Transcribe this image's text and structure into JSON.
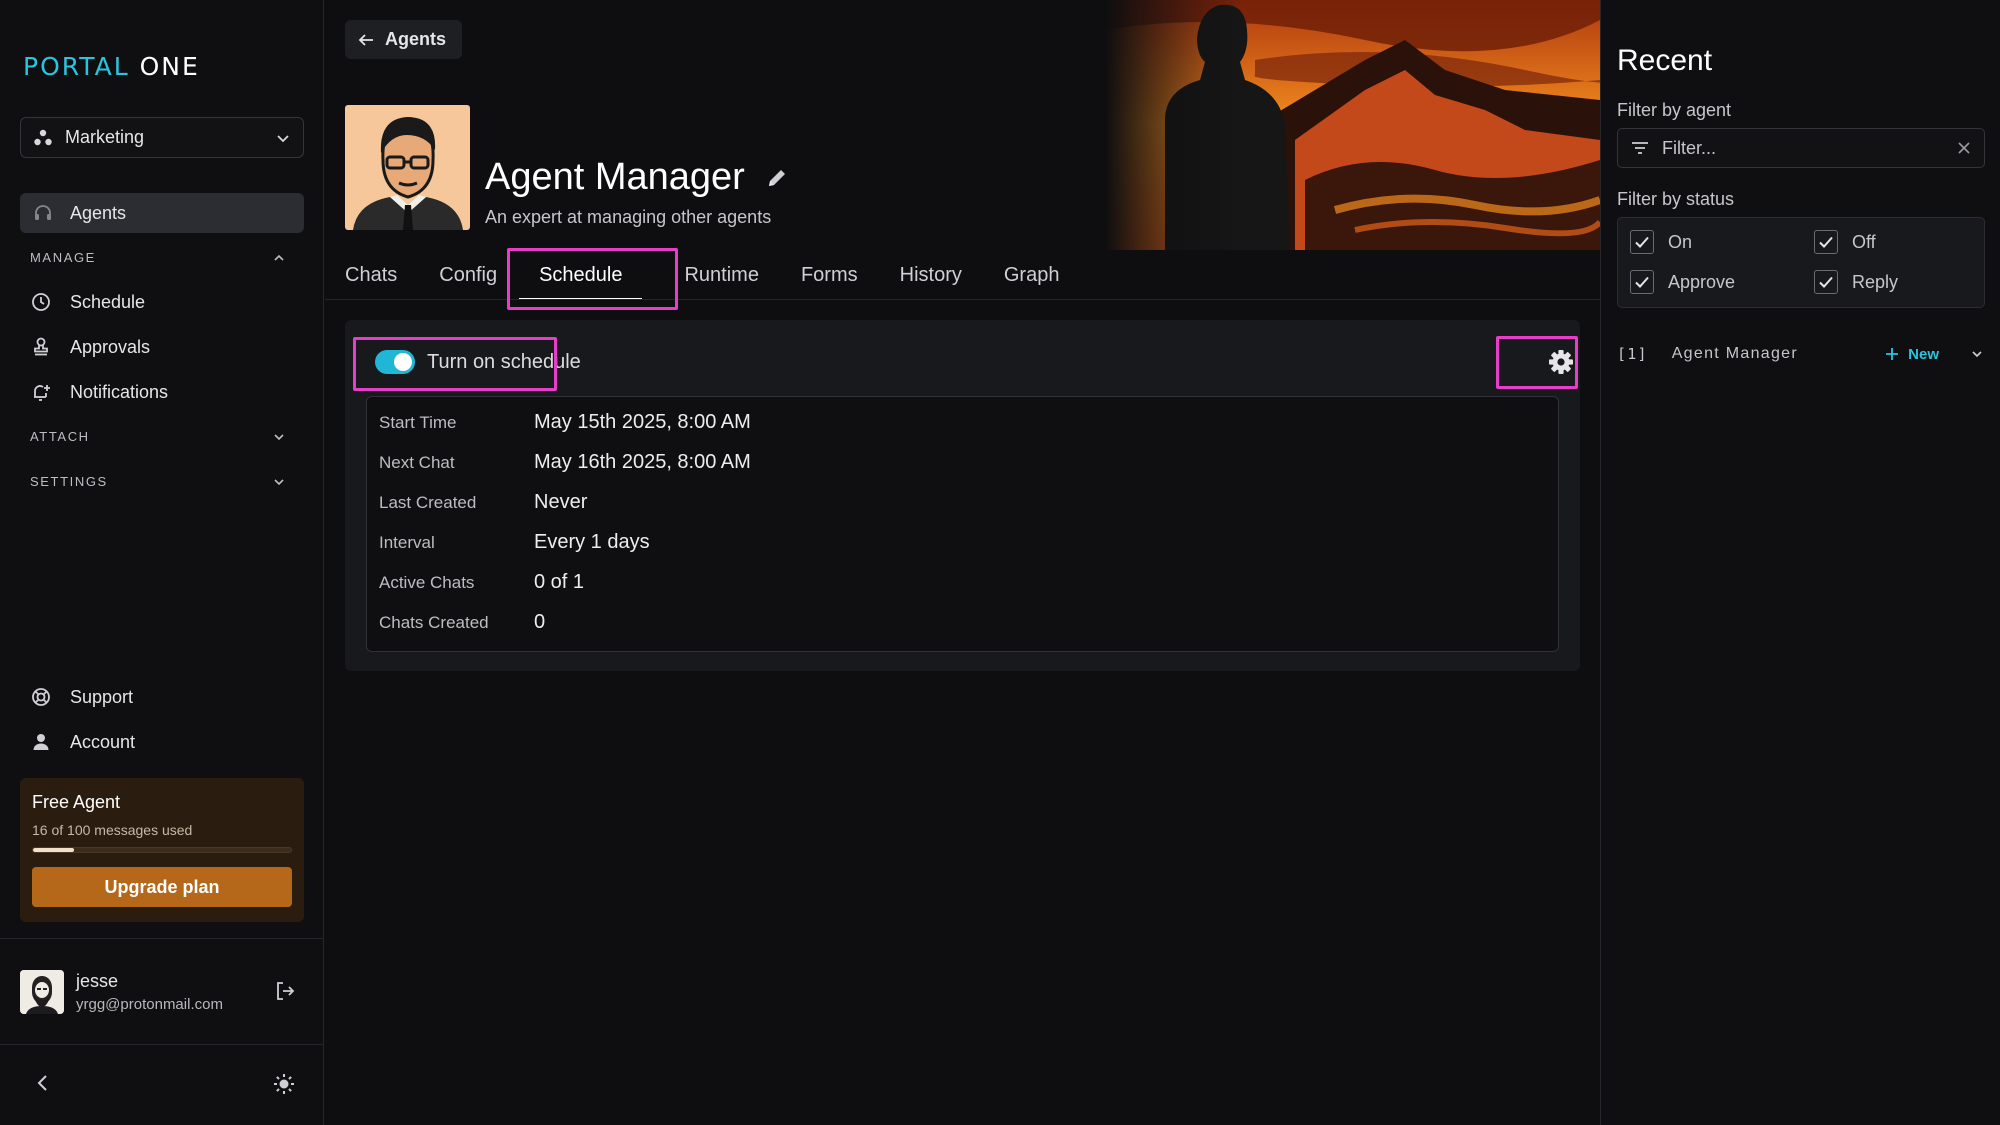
{
  "sidebar": {
    "logo_part1": "PORTAL",
    "logo_part2": "ONE",
    "workspace": "Marketing",
    "active_item": "Agents",
    "manage_header": "MANAGE",
    "manage_items": [
      "Schedule",
      "Approvals",
      "Notifications"
    ],
    "attach_header": "ATTACH",
    "settings_header": "SETTINGS",
    "bottom_items": [
      "Support",
      "Account"
    ],
    "plan": {
      "title": "Free Agent",
      "usage_text": "16 of 100 messages used",
      "usage_fraction": 0.16,
      "upgrade_label": "Upgrade plan"
    },
    "user": {
      "name": "jesse",
      "email": "yrgg@protonmail.com"
    }
  },
  "header": {
    "back_label": "Agents",
    "agent_name": "Agent Manager",
    "agent_description": "An expert at managing other agents"
  },
  "tabs": [
    "Chats",
    "Config",
    "Schedule",
    "Runtime",
    "Forms",
    "History",
    "Graph"
  ],
  "active_tab": "Schedule",
  "schedule": {
    "toggle_label": "Turn on schedule",
    "enabled": true,
    "rows": [
      {
        "label": "Start Time",
        "value": "May 15th 2025, 8:00 AM"
      },
      {
        "label": "Next Chat",
        "value": "May 16th 2025, 8:00 AM"
      },
      {
        "label": "Last Created",
        "value": "Never"
      },
      {
        "label": "Interval",
        "value": "Every 1 days"
      },
      {
        "label": "Active Chats",
        "value": "0 of 1"
      },
      {
        "label": "Chats Created",
        "value": "0"
      }
    ]
  },
  "recent": {
    "title": "Recent",
    "filter_agent_label": "Filter by agent",
    "filter_placeholder": "Filter...",
    "filter_status_label": "Filter by status",
    "statuses": [
      {
        "label": "On",
        "checked": true
      },
      {
        "label": "Off",
        "checked": true
      },
      {
        "label": "Approve",
        "checked": true
      },
      {
        "label": "Reply",
        "checked": true
      }
    ],
    "items": [
      {
        "index": "[1]",
        "name": "Agent Manager",
        "new_label": "New"
      }
    ]
  },
  "colors": {
    "accent": "#2bc4e0",
    "highlight": "#e63ec8",
    "upgrade": "#b5681a"
  }
}
